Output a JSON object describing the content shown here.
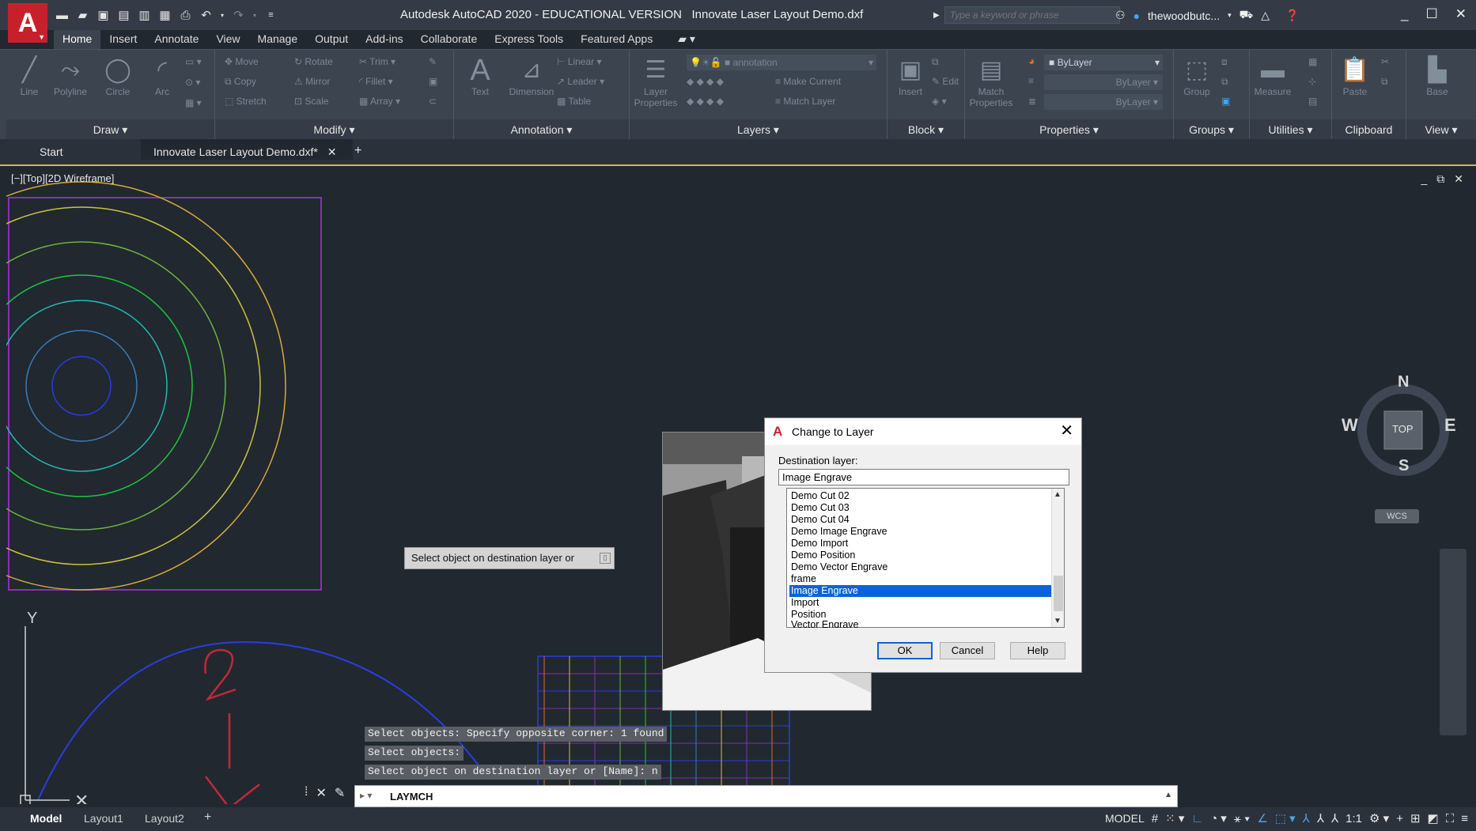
{
  "app": {
    "title": "Autodesk AutoCAD 2020 - EDUCATIONAL VERSION   Innovate Laser Layout Demo.dxf",
    "logo_letter": "A",
    "search_placeholder": "Type a keyword or phrase",
    "username": "thewoodbutc..."
  },
  "ribbon_tabs": [
    "Home",
    "Insert",
    "Annotate",
    "View",
    "Manage",
    "Output",
    "Add-ins",
    "Collaborate",
    "Express Tools",
    "Featured Apps"
  ],
  "ribbon": {
    "draw": {
      "title": "Draw",
      "line": "Line",
      "polyline": "Polyline",
      "circle": "Circle",
      "arc": "Arc"
    },
    "modify": {
      "title": "Modify",
      "move": "Move",
      "rotate": "Rotate",
      "trim": "Trim",
      "copy": "Copy",
      "mirror": "Mirror",
      "fillet": "Fillet",
      "stretch": "Stretch",
      "scale": "Scale",
      "array": "Array"
    },
    "annotation": {
      "title": "Annotation",
      "text": "Text",
      "dimension": "Dimension",
      "linear": "Linear",
      "leader": "Leader",
      "table": "Table"
    },
    "layers": {
      "title": "Layers",
      "layer_properties": "Layer Properties",
      "current_layer": "annotation",
      "make_current": "Make Current",
      "match_layer": "Match Layer"
    },
    "block": {
      "title": "Block",
      "insert": "Insert",
      "edit": "Edit"
    },
    "properties": {
      "title": "Properties",
      "match_properties": "Match Properties",
      "color": "ByLayer",
      "linetype": "ByLayer",
      "lineweight": "ByLayer"
    },
    "groups": {
      "title": "Groups",
      "group": "Group"
    },
    "utilities": {
      "title": "Utilities",
      "measure": "Measure"
    },
    "clipboard": {
      "title": "Clipboard",
      "paste": "Paste"
    },
    "view": {
      "title": "View",
      "base": "Base"
    }
  },
  "doc_tabs": {
    "start": "Start",
    "active": "Innovate Laser Layout Demo.dxf*"
  },
  "viewport": {
    "label": "[−][Top][2D Wireframe]",
    "tooltip": "Select object on destination layer or",
    "compass": {
      "n": "N",
      "s": "S",
      "e": "E",
      "w": "W",
      "top": "TOP",
      "wcs": "WCS"
    }
  },
  "dialog": {
    "title": "Change to Layer",
    "label": "Destination layer:",
    "value": "Image Engrave",
    "items": [
      "Demo Cut 02",
      "Demo Cut 03",
      "Demo Cut 04",
      "Demo Image Engrave",
      "Demo Import",
      "Demo Position",
      "Demo Vector Engrave",
      "frame",
      "Image Engrave",
      "Import",
      "Position",
      "Vector Engrave"
    ],
    "selected_index": 8,
    "ok": "OK",
    "cancel": "Cancel",
    "help": "Help"
  },
  "command_history": [
    "Select objects: Specify opposite corner: 1 found",
    "Select objects:",
    "Select object on destination layer or [Name]: n"
  ],
  "command_input": "LAYMCH",
  "layout_tabs": [
    "Model",
    "Layout1",
    "Layout2"
  ],
  "status": {
    "model": "MODEL",
    "scale": "1:1"
  },
  "colors": {
    "accent": "#c8202a",
    "selection": "#0a63d8",
    "background": "#212830"
  }
}
